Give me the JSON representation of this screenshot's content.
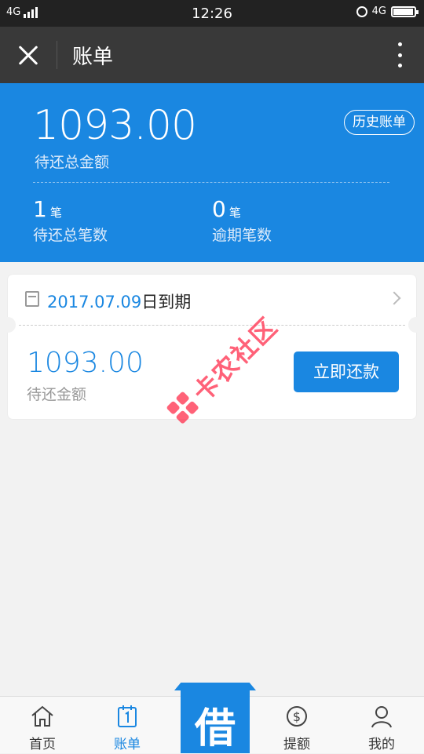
{
  "status_bar": {
    "network_left": "4G",
    "time": "12:26",
    "network_right": "4G",
    "battery_level": 0.95
  },
  "appbar": {
    "title": "账单"
  },
  "summary": {
    "total_amount": "1093.00",
    "total_label": "待还总金额",
    "history_button": "历史账单",
    "pending_count": "1",
    "pending_unit": "笔",
    "pending_label": "待还总笔数",
    "overdue_count": "0",
    "overdue_unit": "笔",
    "overdue_label": "逾期笔数"
  },
  "bill_card": {
    "due_date": "2017.07.09",
    "due_suffix": "日到期",
    "amount": "1093.00",
    "amount_label": "待还金额",
    "pay_button": "立即还款"
  },
  "watermark": {
    "text": "卡农社区"
  },
  "tabbar": {
    "items": [
      {
        "label": "首页",
        "icon": "home-icon"
      },
      {
        "label": "账单",
        "icon": "calendar-icon",
        "active": true
      },
      {
        "label": "借",
        "icon": "borrow-icon"
      },
      {
        "label": "提额",
        "icon": "dollar-icon"
      },
      {
        "label": "我的",
        "icon": "user-icon"
      }
    ]
  },
  "colors": {
    "accent": "#1a87e1",
    "appbar": "#393939",
    "status": "#222222",
    "background": "#f2f2f2"
  }
}
